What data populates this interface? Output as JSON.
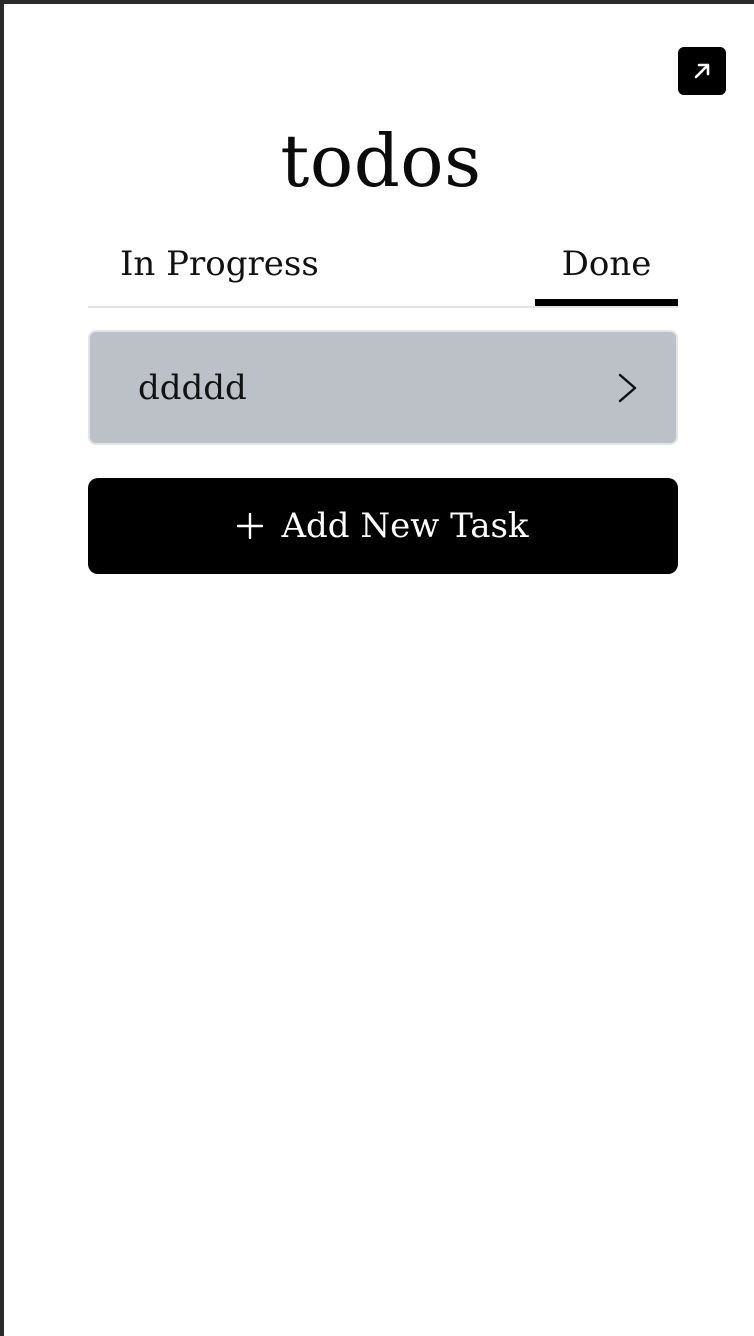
{
  "app": {
    "title": "todos"
  },
  "tabs": [
    {
      "label": "In Progress",
      "active": false
    },
    {
      "label": "Done",
      "active": true
    }
  ],
  "tasks": [
    {
      "title": "ddddd"
    }
  ],
  "actions": {
    "add_task_label": "Add New Task",
    "expand_icon": "arrow-up-right-icon",
    "add_icon": "plus-icon",
    "task_icon": "chevron-right-icon"
  },
  "colors": {
    "accent": "#000000",
    "task_card_bg": "#bcc1c8",
    "tab_divider": "#e4e4e4"
  }
}
